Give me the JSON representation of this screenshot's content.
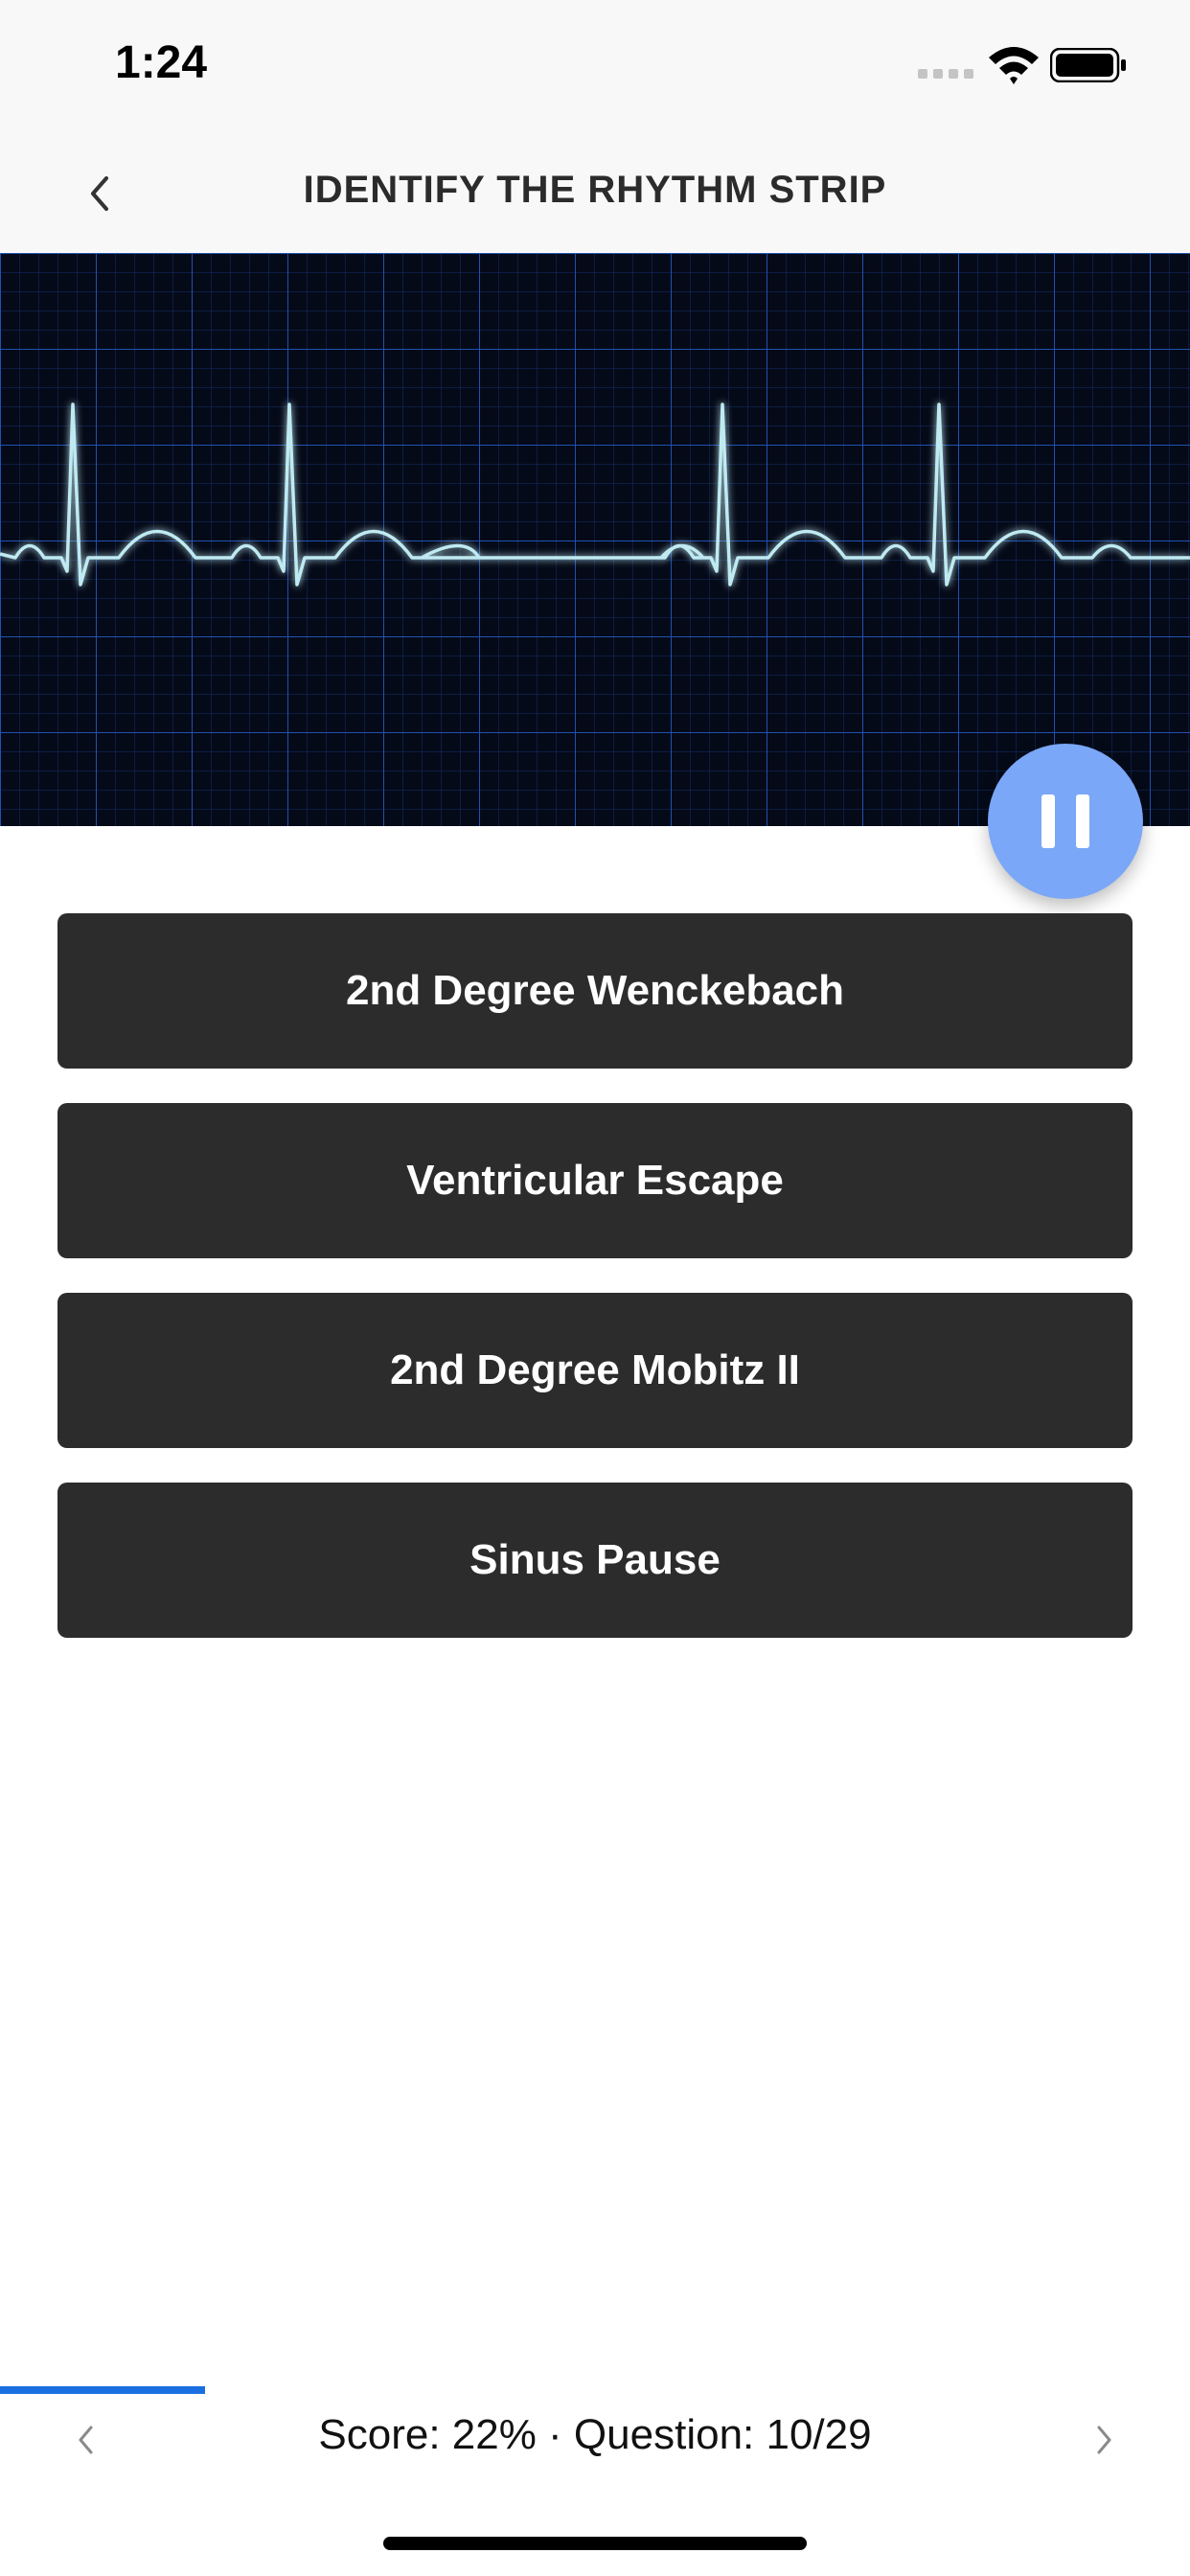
{
  "status_bar": {
    "time": "1:24",
    "icons": [
      "signal-icon",
      "wifi-icon",
      "battery-icon"
    ]
  },
  "nav": {
    "back_icon": "chevron-left-icon",
    "title": "IDENTIFY THE RHYTHM STRIP"
  },
  "rhythm_strip": {
    "image": "ecg-rhythm-strip",
    "background_color": "#050a18",
    "grid_color": "#1b3f8f",
    "trace_color": "#bfeaf2"
  },
  "pause_button": {
    "icon": "pause-icon",
    "color": "#7aa7f7"
  },
  "answers": [
    {
      "label": "2nd Degree Wenckebach"
    },
    {
      "label": "Ventricular Escape"
    },
    {
      "label": "2nd Degree Mobitz II"
    },
    {
      "label": "Sinus Pause"
    }
  ],
  "footer": {
    "progress_fraction": 0.1724,
    "progress_color": "#1a6fe0",
    "score_text": "Score: 22% · Question: 10/29",
    "prev_icon": "chevron-left-icon",
    "next_icon": "chevron-right-icon"
  }
}
